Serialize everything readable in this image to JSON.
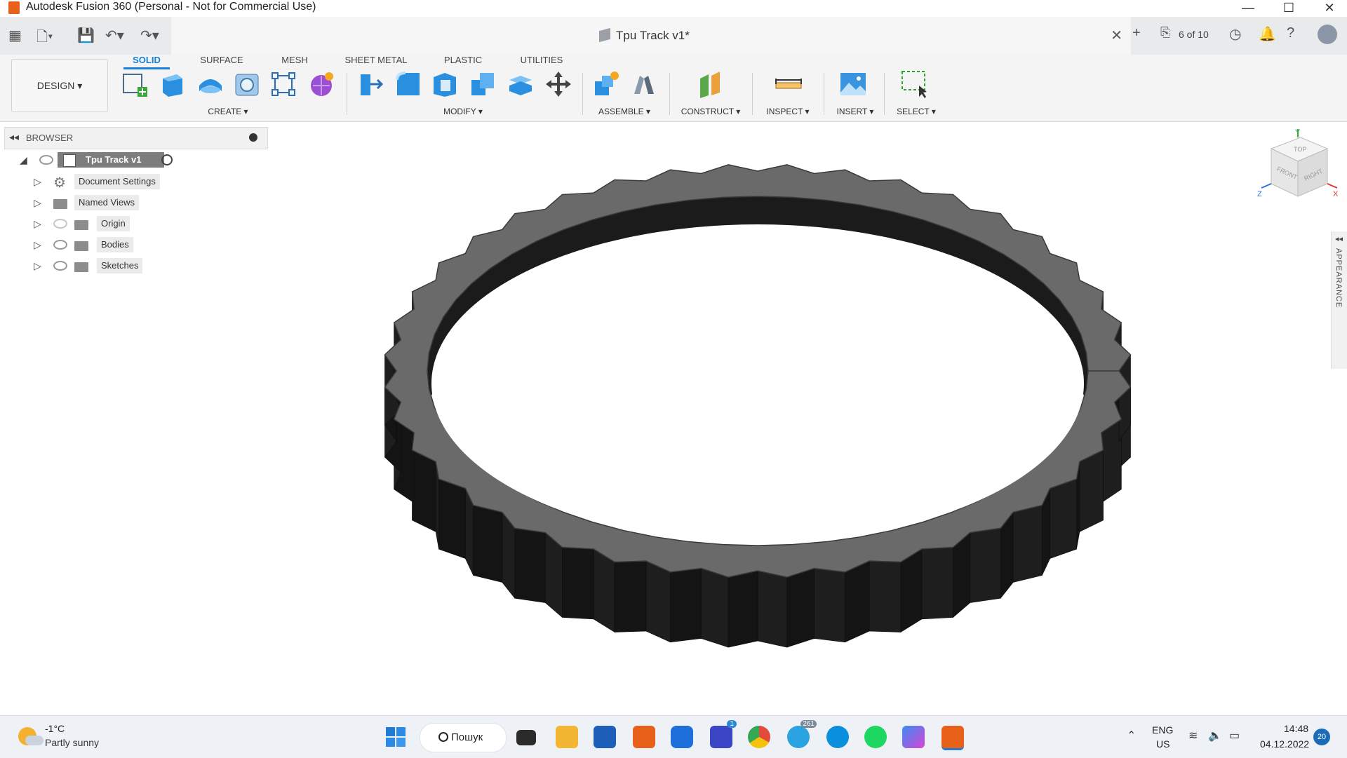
{
  "window": {
    "title": "Autodesk Fusion 360 (Personal - Not for Commercial Use)",
    "controls": [
      "—",
      "☐",
      "✕"
    ]
  },
  "document": {
    "tab_title": "Tpu Track v1*",
    "job_status": "6 of 10"
  },
  "toolbar": {
    "workspace": "DESIGN ▾",
    "tabs": [
      "SOLID",
      "SURFACE",
      "MESH",
      "SHEET METAL",
      "PLASTIC",
      "UTILITIES"
    ],
    "groups": [
      "CREATE ▾",
      "MODIFY ▾",
      "ASSEMBLE ▾",
      "CONSTRUCT ▾",
      "INSPECT ▾",
      "INSERT ▾",
      "SELECT ▾"
    ]
  },
  "browser": {
    "header": "BROWSER",
    "root": "Tpu Track v1",
    "items": [
      "Document Settings",
      "Named Views",
      "Origin",
      "Bodies",
      "Sketches"
    ]
  },
  "viewcube": {
    "faces": [
      "TOP",
      "FRONT",
      "RIGHT"
    ],
    "axes": [
      "Y",
      "Z",
      "X"
    ]
  },
  "side_panel": {
    "label": "APPEARANCE"
  },
  "taskbar": {
    "weather_temp": "-1°C",
    "weather_desc": "Partly sunny",
    "search": "Пошук",
    "lang_top": "ENG",
    "lang_bottom": "US",
    "time": "14:48",
    "date": "04.12.2022",
    "notif_count": "20",
    "badge_teams": "1",
    "badge_telegram": "261"
  },
  "colors": {
    "accent": "#1a7fd8",
    "fusion_orange": "#e8611a",
    "track_dark": "#1b1b1b",
    "track_edge": "#6a6a6a"
  }
}
